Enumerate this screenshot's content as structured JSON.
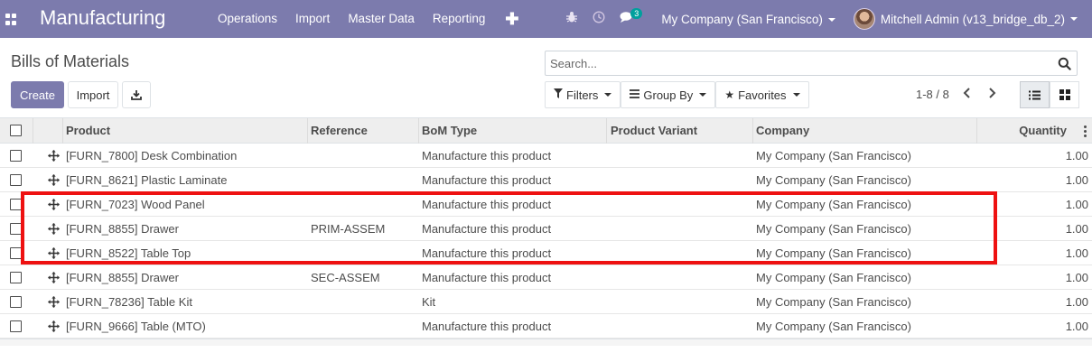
{
  "navbar": {
    "brand": "Manufacturing",
    "menu": [
      "Operations",
      "Import",
      "Master Data",
      "Reporting"
    ],
    "add_icon": "plus-icon",
    "messages_badge": "3",
    "company": "My Company (San Francisco)",
    "user": "Mitchell Admin (v13_bridge_db_2)",
    "accent_color": "#7c7bad"
  },
  "control": {
    "title": "Bills of Materials",
    "search_placeholder": "Search...",
    "create_label": "Create",
    "import_label": "Import",
    "filters_label": "Filters",
    "groupby_label": "Group By",
    "favorites_label": "Favorites",
    "pager": "1-8 / 8"
  },
  "table": {
    "columns": [
      "Product",
      "Reference",
      "BoM Type",
      "Product Variant",
      "Company",
      "Quantity"
    ],
    "rows": [
      {
        "product": "[FURN_7800] Desk Combination",
        "reference": "",
        "bom_type": "Manufacture this product",
        "variant": "",
        "company": "My Company (San Francisco)",
        "quantity": "1.00"
      },
      {
        "product": "[FURN_8621] Plastic Laminate",
        "reference": "",
        "bom_type": "Manufacture this product",
        "variant": "",
        "company": "My Company (San Francisco)",
        "quantity": "1.00"
      },
      {
        "product": "[FURN_7023] Wood Panel",
        "reference": "",
        "bom_type": "Manufacture this product",
        "variant": "",
        "company": "My Company (San Francisco)",
        "quantity": "1.00"
      },
      {
        "product": "[FURN_8855] Drawer",
        "reference": "PRIM-ASSEM",
        "bom_type": "Manufacture this product",
        "variant": "",
        "company": "My Company (San Francisco)",
        "quantity": "1.00"
      },
      {
        "product": "[FURN_8522] Table Top",
        "reference": "",
        "bom_type": "Manufacture this product",
        "variant": "",
        "company": "My Company (San Francisco)",
        "quantity": "1.00"
      },
      {
        "product": "[FURN_8855] Drawer",
        "reference": "SEC-ASSEM",
        "bom_type": "Manufacture this product",
        "variant": "",
        "company": "My Company (San Francisco)",
        "quantity": "1.00"
      },
      {
        "product": "[FURN_78236] Table Kit",
        "reference": "",
        "bom_type": "Kit",
        "variant": "",
        "company": "My Company (San Francisco)",
        "quantity": "1.00"
      },
      {
        "product": "[FURN_9666] Table (MTO)",
        "reference": "",
        "bom_type": "Manufacture this product",
        "variant": "",
        "company": "My Company (San Francisco)",
        "quantity": "1.00"
      }
    ]
  },
  "annotation": {
    "highlight_color": "#ee1111"
  }
}
